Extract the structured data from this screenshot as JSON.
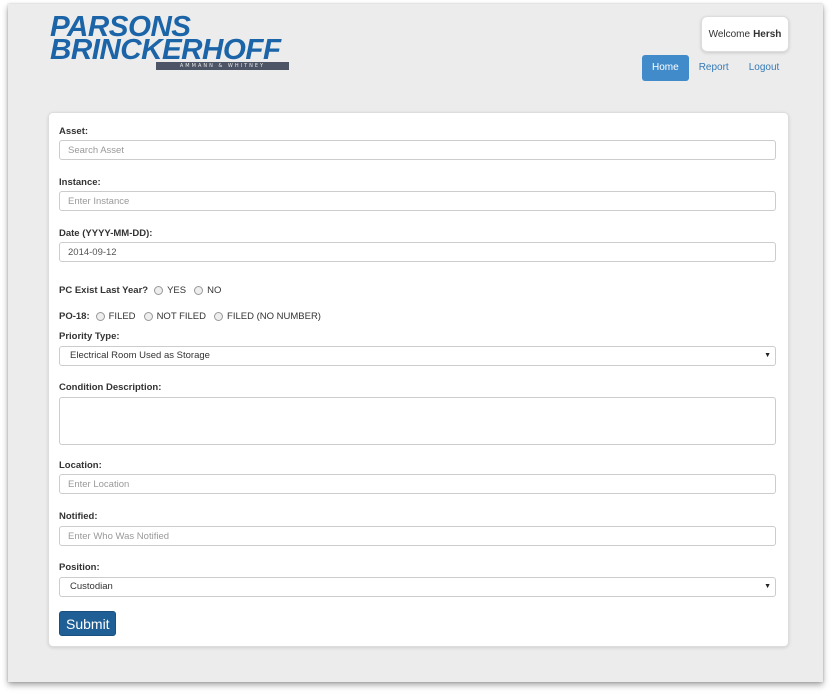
{
  "brand": {
    "line1": "PARSONS",
    "line2": "BRINCKERHOFF",
    "sub": "AMMANN & WHITNEY"
  },
  "header": {
    "welcome_prefix": "Welcome",
    "user": "Hersh"
  },
  "nav": {
    "home": "Home",
    "report": "Report",
    "logout": "Logout"
  },
  "form": {
    "asset": {
      "label": "Asset:",
      "placeholder": "Search Asset"
    },
    "instance": {
      "label": "Instance:",
      "placeholder": "Enter Instance"
    },
    "date": {
      "label": "Date (YYYY-MM-DD):",
      "value": "2014-09-12"
    },
    "pc_exist": {
      "label": "PC Exist Last Year?",
      "options": [
        "YES",
        "NO"
      ]
    },
    "po18": {
      "label": "PO-18:",
      "options": [
        "FILED",
        "NOT FILED",
        "FILED (NO NUMBER)"
      ]
    },
    "priority": {
      "label": "Priority Type:",
      "value": "Electrical Room Used as Storage"
    },
    "condition": {
      "label": "Condition Description:",
      "value": ""
    },
    "location": {
      "label": "Location:",
      "placeholder": "Enter Location"
    },
    "notified": {
      "label": "Notified:",
      "placeholder": "Enter Who Was Notified"
    },
    "position": {
      "label": "Position:",
      "value": "Custodian"
    },
    "submit": "Submit"
  },
  "colors": {
    "brand_blue": "#1b64a8",
    "active_nav": "#428bca",
    "submit": "#1f5f96"
  }
}
